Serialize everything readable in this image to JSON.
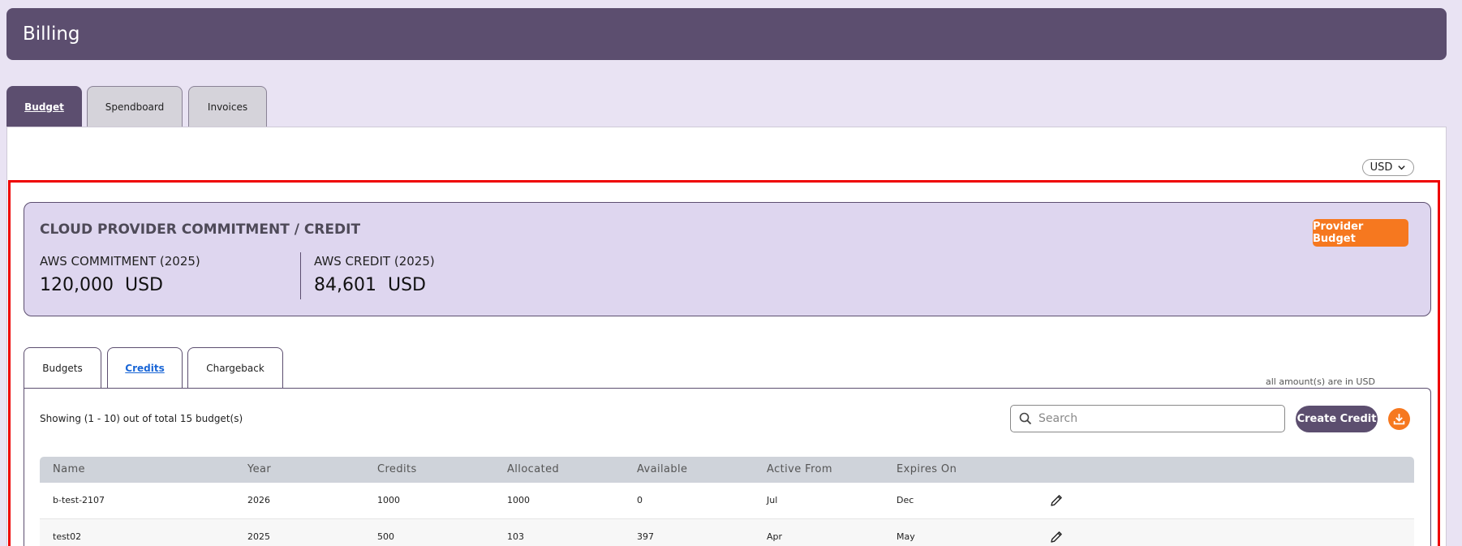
{
  "header": {
    "title": "Billing"
  },
  "main_tabs": [
    {
      "label": "Budget",
      "active": true
    },
    {
      "label": "Spendboard",
      "active": false
    },
    {
      "label": "Invoices",
      "active": false
    }
  ],
  "currency": {
    "selected": "USD",
    "icon": "chevron-down-icon"
  },
  "commitment_card": {
    "title": "CLOUD PROVIDER COMMITMENT / CREDIT",
    "button_label": "Provider Budget",
    "metrics": [
      {
        "label": "AWS COMMITMENT (2025)",
        "value": "120,000",
        "unit": "USD"
      },
      {
        "label": "AWS CREDIT (2025)",
        "value": "84,601",
        "unit": "USD"
      }
    ]
  },
  "sub_tabs": [
    {
      "label": "Budgets",
      "active": false
    },
    {
      "label": "Credits",
      "active": true
    },
    {
      "label": "Chargeback",
      "active": false
    }
  ],
  "amount_note": "all amount(s) are in USD",
  "table": {
    "showing": "Showing  (1 - 10) out of total 15 budget(s)",
    "search_placeholder": "Search",
    "search_value": "",
    "create_label": "Create Credit",
    "download_icon": "download-icon",
    "columns": [
      "Name",
      "Year",
      "Credits",
      "Allocated",
      "Available",
      "Active From",
      "Expires On"
    ],
    "rows": [
      {
        "name": "b-test-2107",
        "year": "2026",
        "credits": "1000",
        "allocated": "1000",
        "available": "0",
        "active_from": "Jul",
        "expires_on": "Dec"
      },
      {
        "name": "test02",
        "year": "2025",
        "credits": "500",
        "allocated": "103",
        "available": "397",
        "active_from": "Apr",
        "expires_on": "May"
      }
    ]
  },
  "colors": {
    "accent": "#5c4e6f",
    "orange": "#f6781f",
    "card_bg": "#ded6ef",
    "page_bg": "#e9e3f3",
    "highlight_frame": "#ee0000"
  }
}
